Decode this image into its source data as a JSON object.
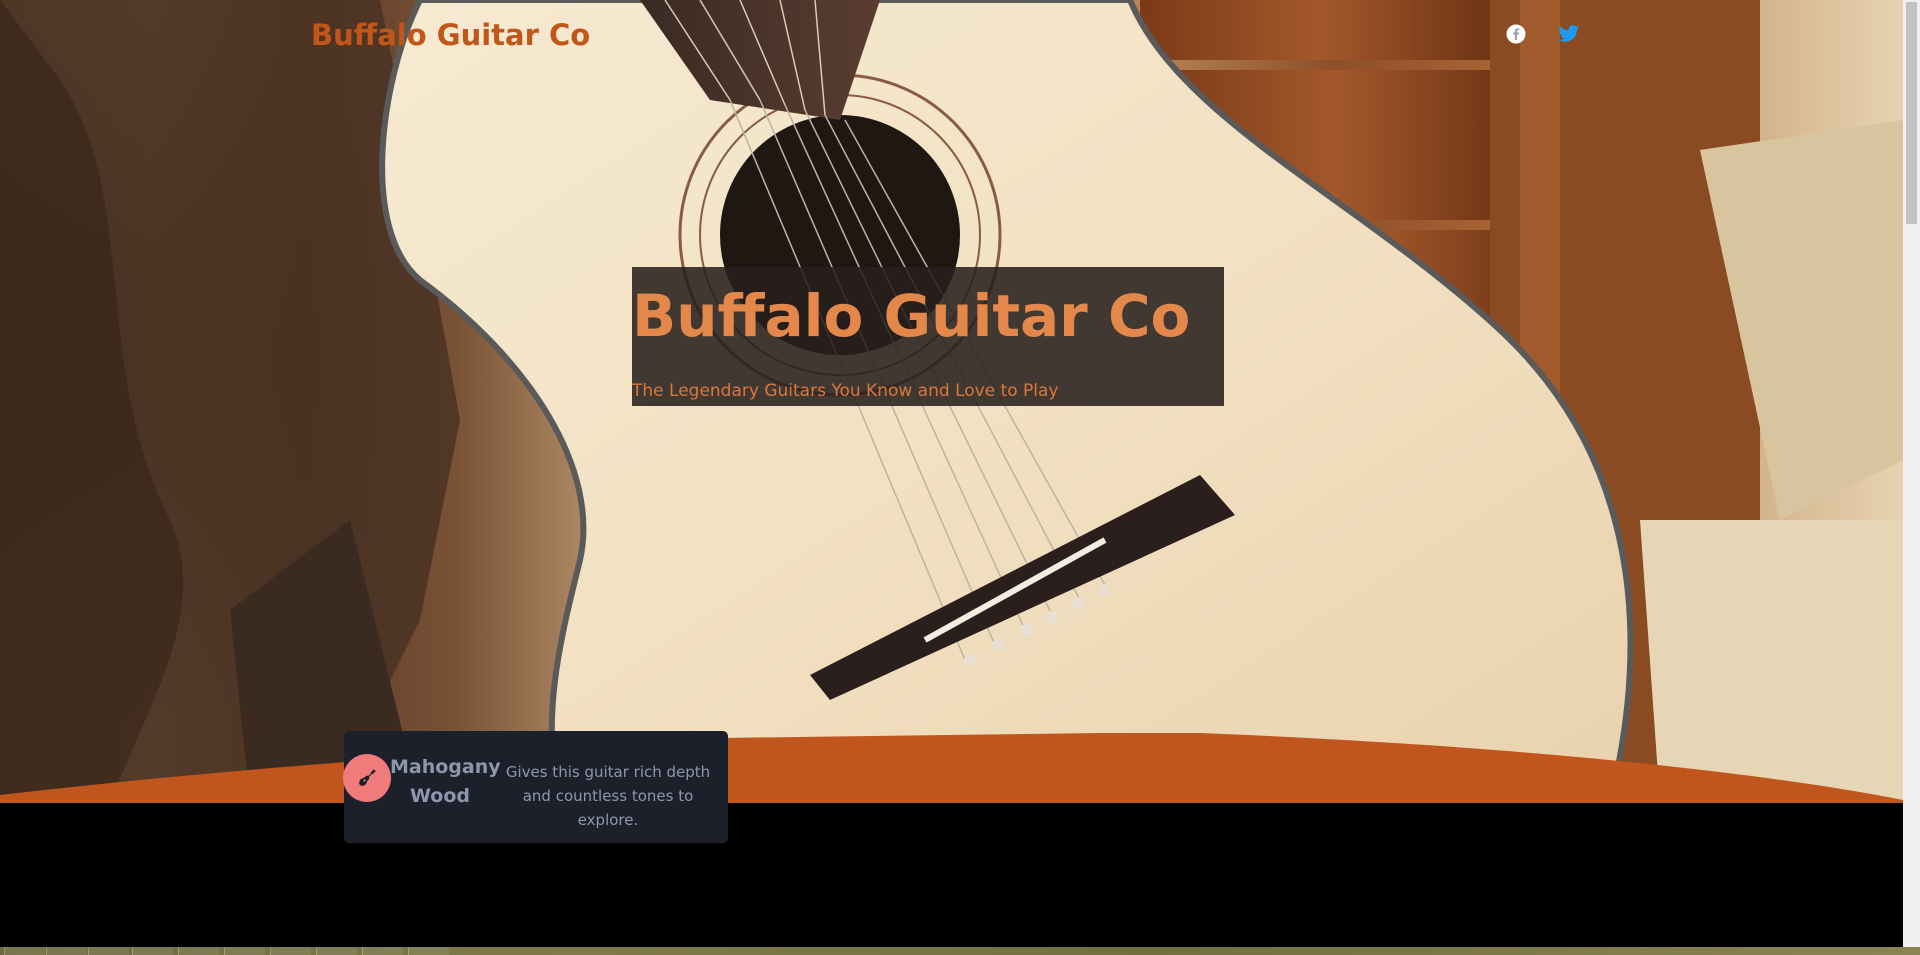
{
  "nav": {
    "brand": "Buffalo Guitar Co",
    "social": [
      "facebook-icon",
      "twitter-icon"
    ]
  },
  "hero": {
    "title": "Buffalo Guitar Co",
    "tagline": "The Legendary Guitars You Know and Love to Play"
  },
  "feature": {
    "icon": "guitar-icon",
    "title": "Mahogany Wood",
    "description": "Gives this guitar rich depth and countless tones to explore."
  },
  "colors": {
    "brand": "#c25618",
    "headline": "#e3884a",
    "accent_band": "#c0561d",
    "card_bg": "#1c202b",
    "icon_bg": "#f07b7b",
    "twitter": "#1d9bf0"
  }
}
